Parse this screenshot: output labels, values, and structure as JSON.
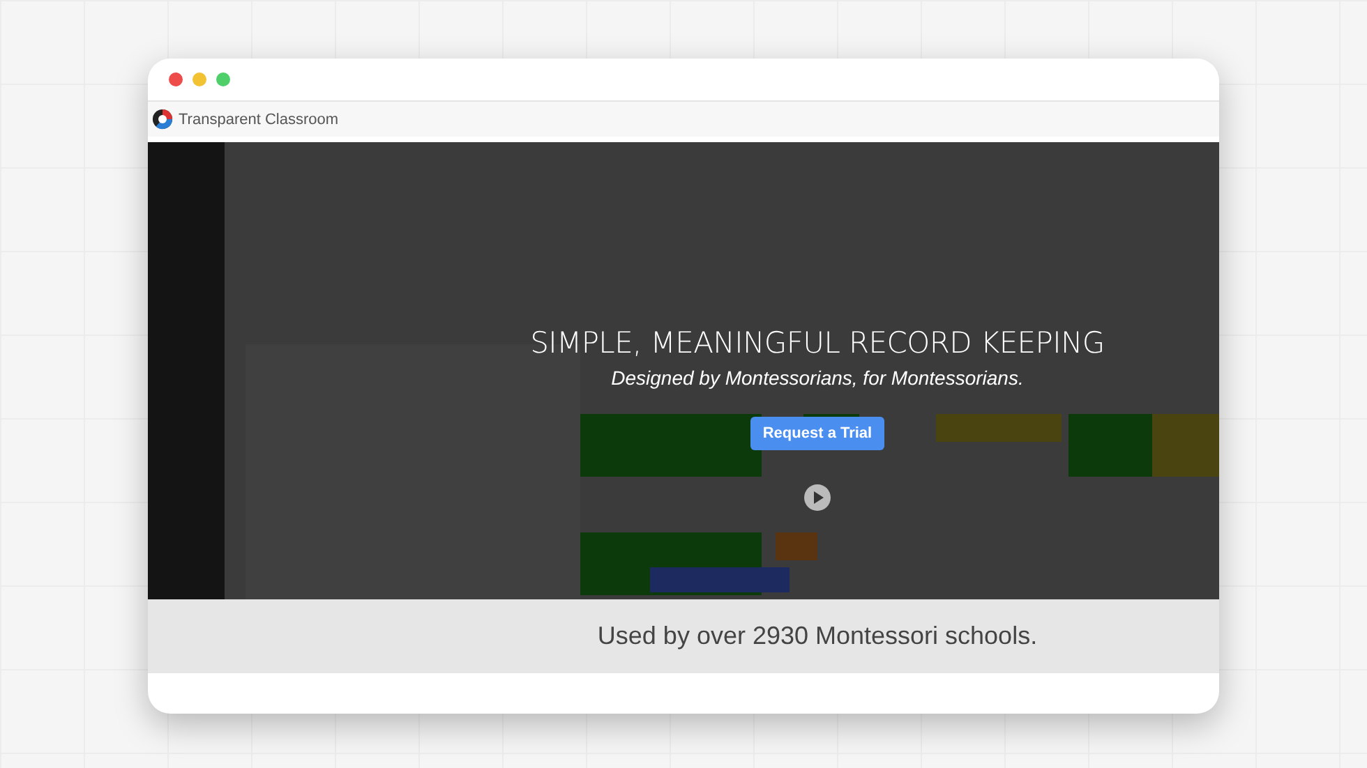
{
  "window": {
    "traffic_lights": [
      {
        "color": "#ee4b4b"
      },
      {
        "color": "#f2c233"
      },
      {
        "color": "#4fcf6a"
      }
    ]
  },
  "tab": {
    "title": "Transparent Classroom"
  },
  "video": {
    "kind": "picture",
    "headline": "SIMPLE, MEANINGFUL RECORD KEEPING",
    "subtitle": "Designed by Montessorians, for Montessorians.",
    "button": "Request a Trial"
  },
  "footer": {
    "text": "Used by over 2930 Montessori schools."
  }
}
